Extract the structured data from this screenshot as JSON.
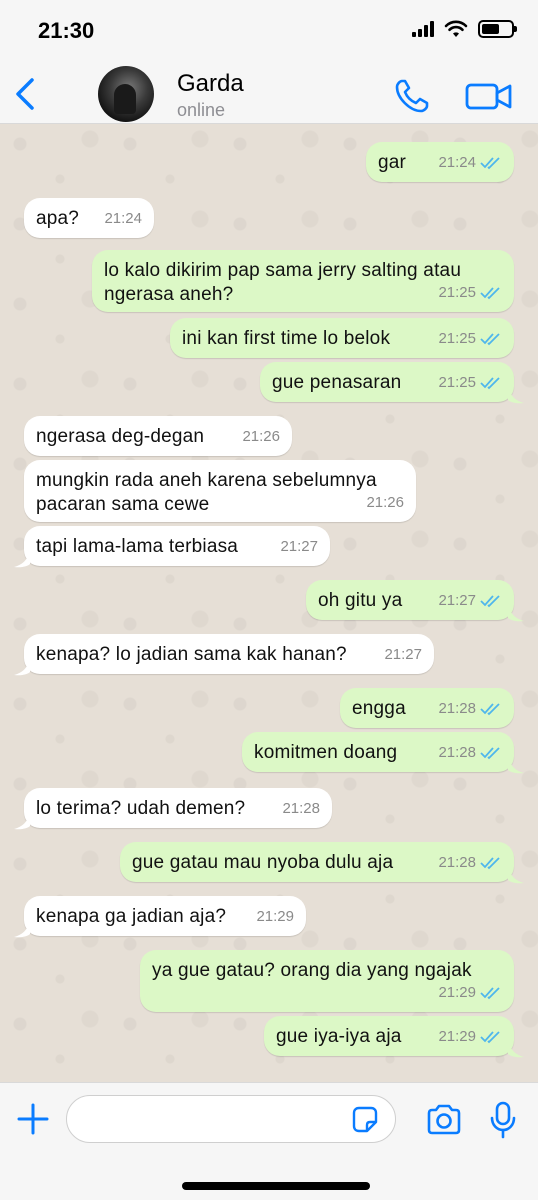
{
  "status_bar": {
    "time": "21:30"
  },
  "header": {
    "name": "Garda",
    "status": "online"
  },
  "messages": [
    {
      "text": "gar",
      "time": "21:24",
      "dir": "out"
    },
    {
      "text": "apa?",
      "time": "21:24",
      "dir": "in"
    },
    {
      "text": "lo kalo dikirim pap sama jerry salting atau ngerasa aneh?",
      "time": "21:25",
      "dir": "out"
    },
    {
      "text": "ini kan first time lo belok",
      "time": "21:25",
      "dir": "out"
    },
    {
      "text": "gue penasaran",
      "time": "21:25",
      "dir": "out"
    },
    {
      "text": "ngerasa deg-degan",
      "time": "21:26",
      "dir": "in"
    },
    {
      "text": "mungkin rada aneh karena sebelumnya pacaran sama cewe",
      "time": "21:26",
      "dir": "in"
    },
    {
      "text": "tapi lama-lama terbiasa",
      "time": "21:27",
      "dir": "in"
    },
    {
      "text": "oh gitu ya",
      "time": "21:27",
      "dir": "out"
    },
    {
      "text": "kenapa? lo jadian sama kak hanan?",
      "time": "21:27",
      "dir": "in"
    },
    {
      "text": "engga",
      "time": "21:28",
      "dir": "out"
    },
    {
      "text": "komitmen doang",
      "time": "21:28",
      "dir": "out"
    },
    {
      "text": "lo terima? udah demen?",
      "time": "21:28",
      "dir": "in"
    },
    {
      "text": "gue gatau mau nyoba dulu aja",
      "time": "21:28",
      "dir": "out"
    },
    {
      "text": "kenapa ga jadian aja?",
      "time": "21:29",
      "dir": "in"
    },
    {
      "text": "ya gue gatau? orang dia yang ngajak",
      "time": "21:29",
      "dir": "out"
    },
    {
      "text": "gue iya-iya aja",
      "time": "21:29",
      "dir": "out"
    }
  ],
  "composer": {
    "value": ""
  },
  "colors": {
    "accent": "#0a7cff",
    "outgoing_bubble": "#dcf8c6",
    "incoming_bubble": "#ffffff",
    "read_ticks": "#4fb6ec"
  }
}
